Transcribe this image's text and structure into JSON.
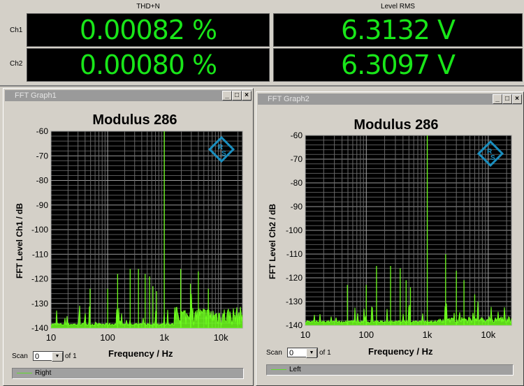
{
  "meters": {
    "col_thd": "THD+N",
    "col_level": "Level RMS",
    "rows": [
      {
        "label": "Ch1",
        "thd": "0.00082 %",
        "level": "6.3132 V"
      },
      {
        "label": "Ch2",
        "thd": "0.00080 %",
        "level": "6.3097 V"
      }
    ]
  },
  "colors": {
    "trace": "#6eff1e",
    "display_text": "#19e619",
    "logo": "#1a8fc0"
  },
  "window_buttons": {
    "min": "_",
    "max": "□",
    "close": "×"
  },
  "chart_data": [
    {
      "type": "line",
      "window_title": "FFT Graph1",
      "title": "Modulus 286",
      "ylabel": "FFT Level Ch1 / dB",
      "xlabel": "Frequency / Hz",
      "xscale": "log",
      "xlim": [
        10,
        24000
      ],
      "ylim": [
        -140,
        -60
      ],
      "yticks": [
        "-60",
        "-70",
        "-80",
        "-90",
        "-100",
        "-110",
        "-120",
        "-130",
        "-140"
      ],
      "xticks": [
        "10",
        "100",
        "1k",
        "10k"
      ],
      "grid": true,
      "scan_label": "Scan",
      "scan_value": "0",
      "scan_of": "of 1",
      "legend": [
        "Right"
      ],
      "peaks": [
        [
          49,
          -124
        ],
        [
          100,
          -124
        ],
        [
          150,
          -118
        ],
        [
          250,
          -116
        ],
        [
          350,
          -116
        ],
        [
          460,
          -118
        ],
        [
          550,
          -119
        ],
        [
          630,
          -123
        ],
        [
          730,
          -125
        ],
        [
          1000,
          -60
        ],
        [
          1950,
          -116
        ],
        [
          2900,
          -122
        ],
        [
          4000,
          -117
        ],
        [
          6000,
          -124
        ]
      ],
      "noise_floor": -139
    },
    {
      "type": "line",
      "window_title": "FFT Graph2",
      "title": "Modulus 286",
      "ylabel": "FFT Level Ch2 / dB",
      "xlabel": "Frequency / Hz",
      "xscale": "log",
      "xlim": [
        10,
        24000
      ],
      "ylim": [
        -140,
        -60
      ],
      "yticks": [
        "-60",
        "-70",
        "-80",
        "-90",
        "-100",
        "-110",
        "-120",
        "-130",
        "-140"
      ],
      "xticks": [
        "10",
        "100",
        "1k",
        "10k"
      ],
      "grid": true,
      "scan_label": "Scan",
      "scan_value": "0",
      "scan_of": "of 1",
      "legend": [
        "Left"
      ],
      "peaks": [
        [
          49,
          -123
        ],
        [
          100,
          -123
        ],
        [
          147,
          -115
        ],
        [
          250,
          -115
        ],
        [
          360,
          -116
        ],
        [
          450,
          -121
        ],
        [
          530,
          -124
        ],
        [
          1000,
          -60
        ],
        [
          2000,
          -110
        ],
        [
          3000,
          -117
        ],
        [
          4000,
          -121
        ],
        [
          6000,
          -127
        ]
      ],
      "noise_floor": -139
    }
  ]
}
